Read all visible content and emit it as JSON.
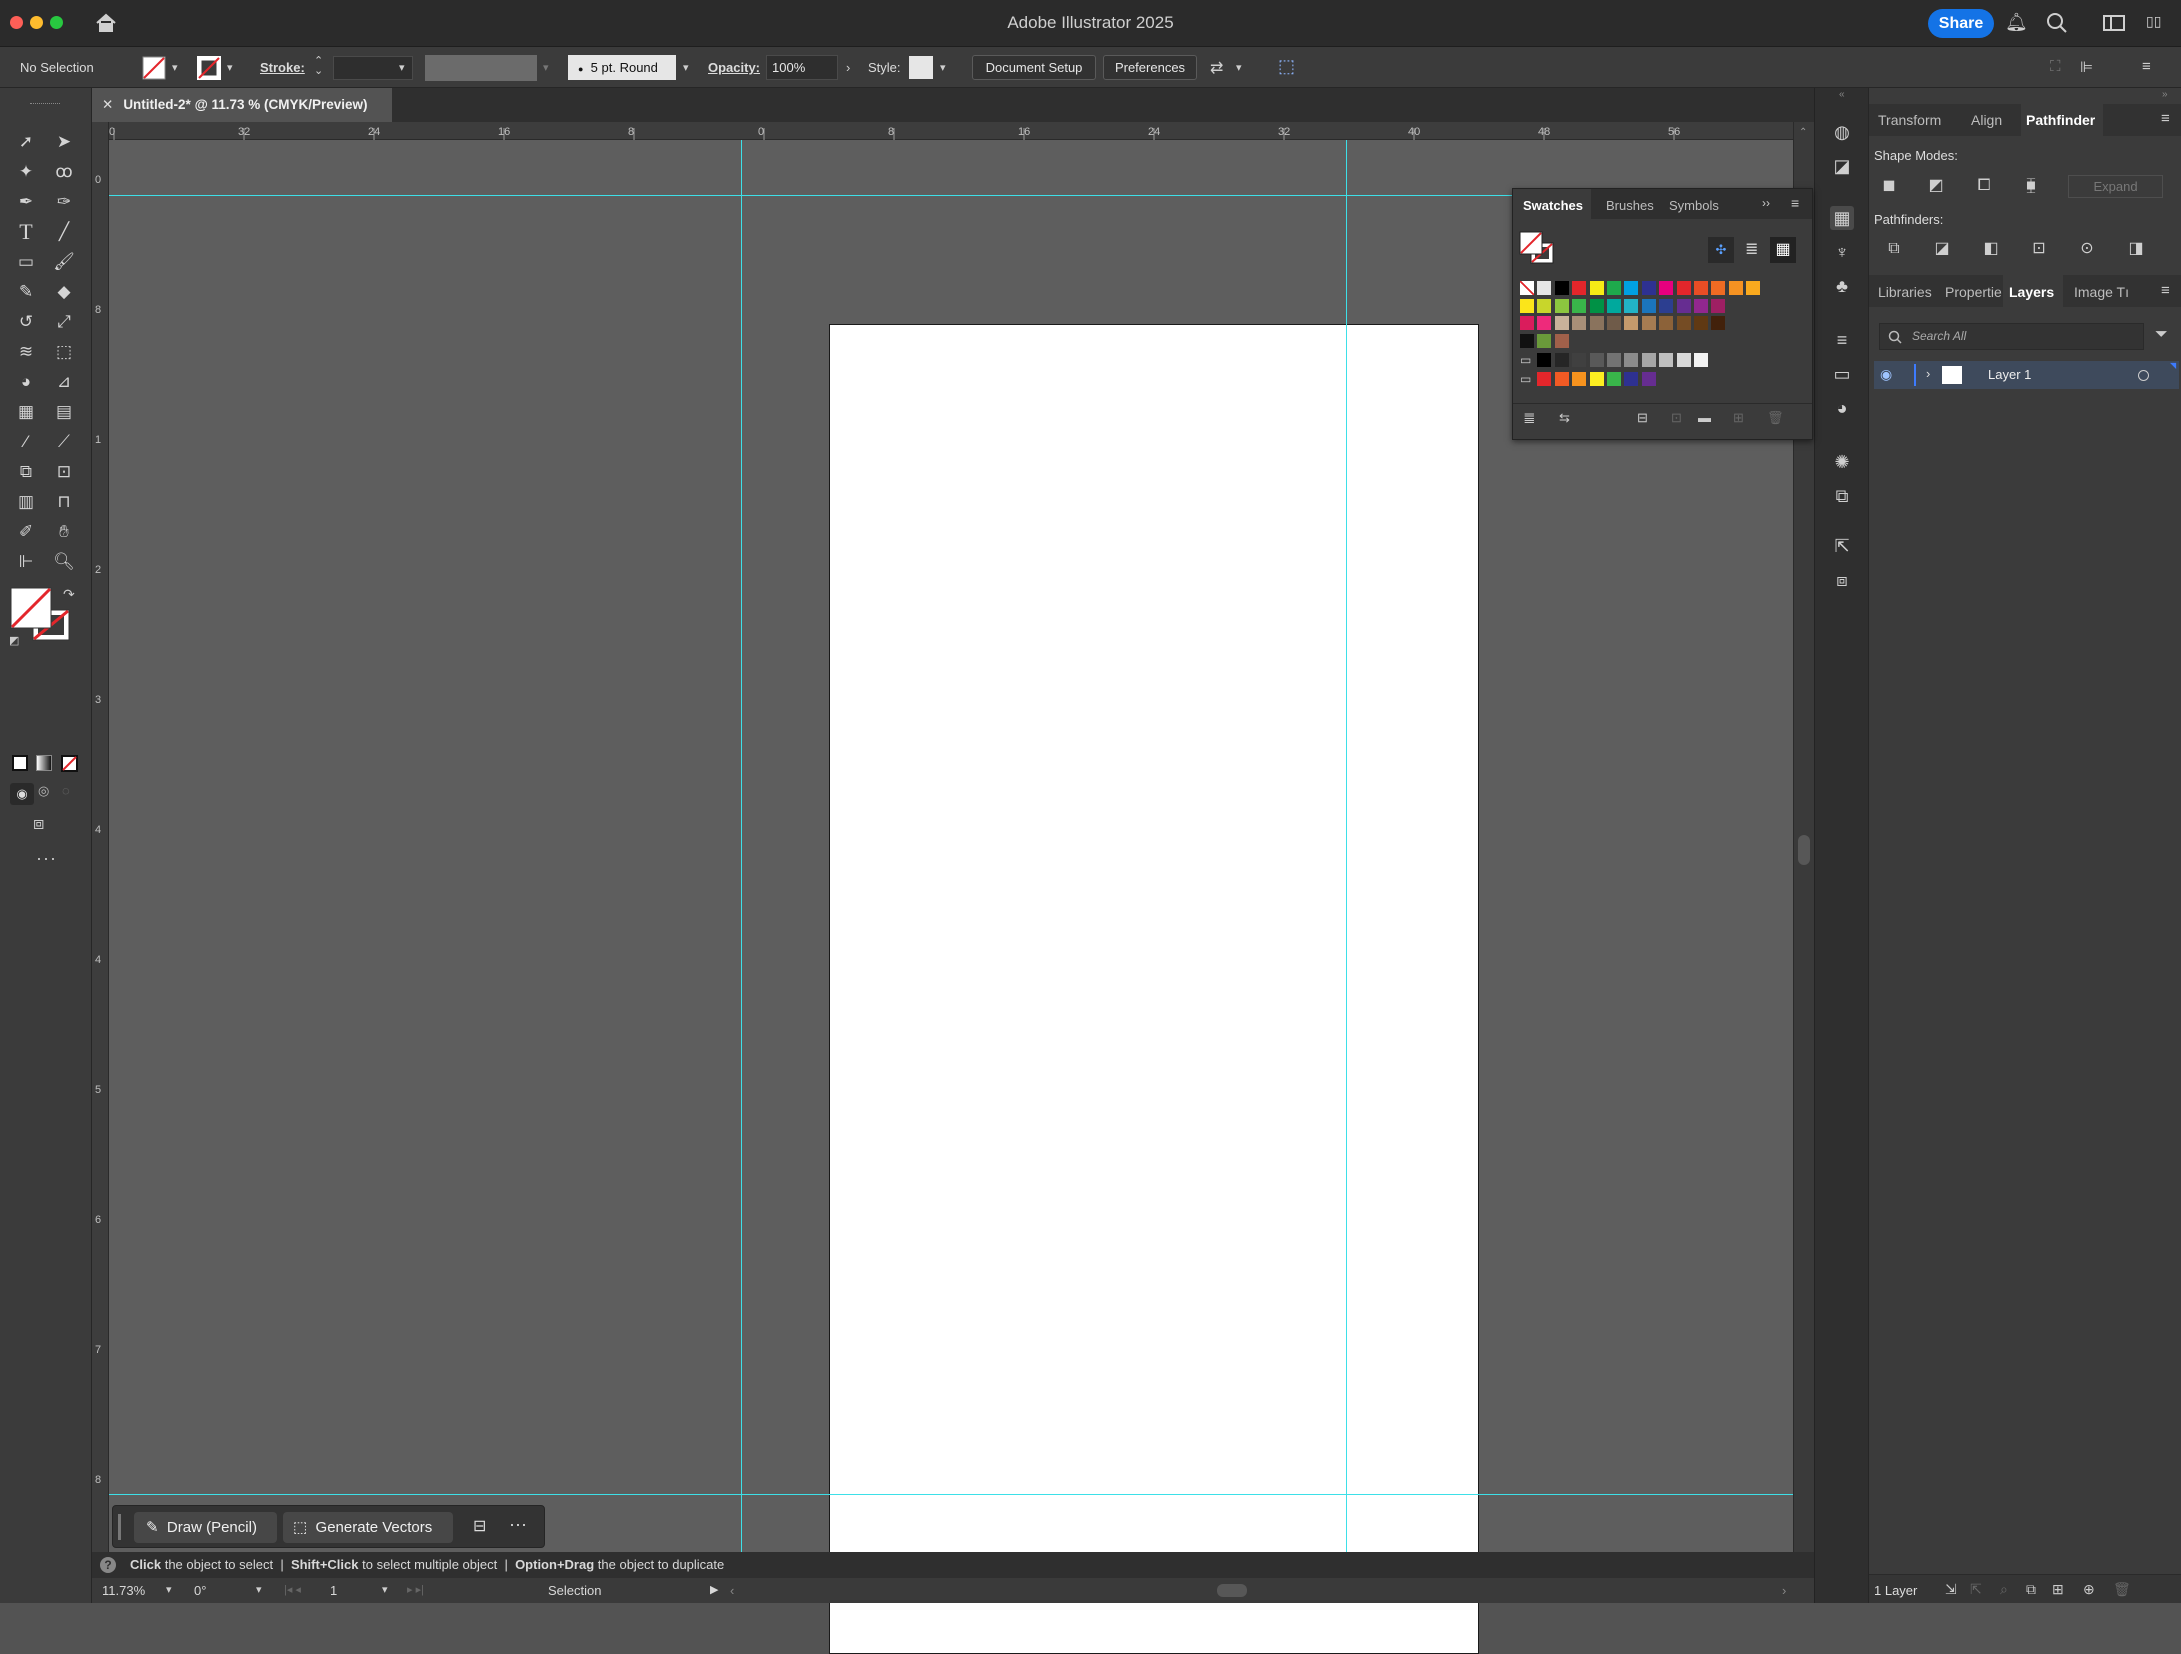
{
  "app": {
    "title": "Adobe Illustrator 2025",
    "share_label": "Share"
  },
  "control": {
    "selection": "No Selection",
    "stroke_label": "Stroke:",
    "brush_label": "5 pt. Round",
    "opacity_label": "Opacity:",
    "opacity_value": "100%",
    "style_label": "Style:",
    "document_setup": "Document Setup",
    "preferences": "Preferences"
  },
  "document": {
    "tab_title": "Untitled-2* @ 11.73 % (CMYK/Preview)"
  },
  "rulers": {
    "top": [
      "0",
      "32",
      "24",
      "16",
      "8",
      "0",
      "8",
      "16",
      "24",
      "32",
      "40",
      "48",
      "56"
    ],
    "left": [
      "0",
      "8",
      "1",
      "2",
      "3",
      "4",
      "4",
      "5",
      "6",
      "7",
      "8"
    ]
  },
  "taskbar": {
    "draw": "Draw (Pencil)",
    "generate": "Generate Vectors"
  },
  "status": {
    "hint_bold1": "Click",
    "hint1": "the object to select",
    "hint_bold2": "Shift+Click",
    "hint2": "to select multiple object",
    "hint_bold3": "Option+Drag",
    "hint3": "the object to duplicate",
    "zoom": "11.73%",
    "rotation": "0°",
    "artboard": "1",
    "tool": "Selection"
  },
  "panels": {
    "top_tabs": [
      "Transform",
      "Align",
      "Pathfinder"
    ],
    "shape_modes": "Shape Modes:",
    "expand": "Expand",
    "pathfinders": "Pathfinders:",
    "mid_tabs": [
      "Libraries",
      "Propertie",
      "Layers",
      "Image Tı"
    ],
    "search_placeholder": "Search All",
    "layer_name": "Layer 1",
    "layer_count": "1 Layer"
  },
  "swatches": {
    "tabs": [
      "Swatches",
      "Brushes",
      "Symbols"
    ],
    "row1": [
      "#ffffff",
      "#e6e6e6",
      "#000000",
      "#e3262b",
      "#f6eb16",
      "#1ea94c",
      "#00a0e2",
      "#2e3191",
      "#e6007e",
      "#e3262b",
      "#e84d25",
      "#ef6b23",
      "#f59222",
      "#f9a91e"
    ],
    "row2": [
      "#fbe51a",
      "#c8d62b",
      "#8cc63f",
      "#39b54a",
      "#009145",
      "#00a99d",
      "#22b3c6",
      "#1b75bc",
      "#2c3e90",
      "#662d91",
      "#92278f",
      "#9e1f63"
    ],
    "row3": [
      "#da1c5c",
      "#ee2a7b",
      "#c9b29a",
      "#a88f78",
      "#8a735d",
      "#6f5b49",
      "#c49a6c",
      "#a67c52",
      "#8c6239",
      "#754c24",
      "#603913",
      "#42210b"
    ],
    "gray": [
      "#000000",
      "#262626",
      "#404040",
      "#595959",
      "#737373",
      "#8c8c8c",
      "#a6a6a6",
      "#bfbfbf",
      "#d9d9d9",
      "#f2f2f2"
    ],
    "bright": [
      "#e3262b",
      "#f15a24",
      "#f7931e",
      "#fcee21",
      "#39b54a",
      "#2e3191",
      "#662d91"
    ]
  }
}
